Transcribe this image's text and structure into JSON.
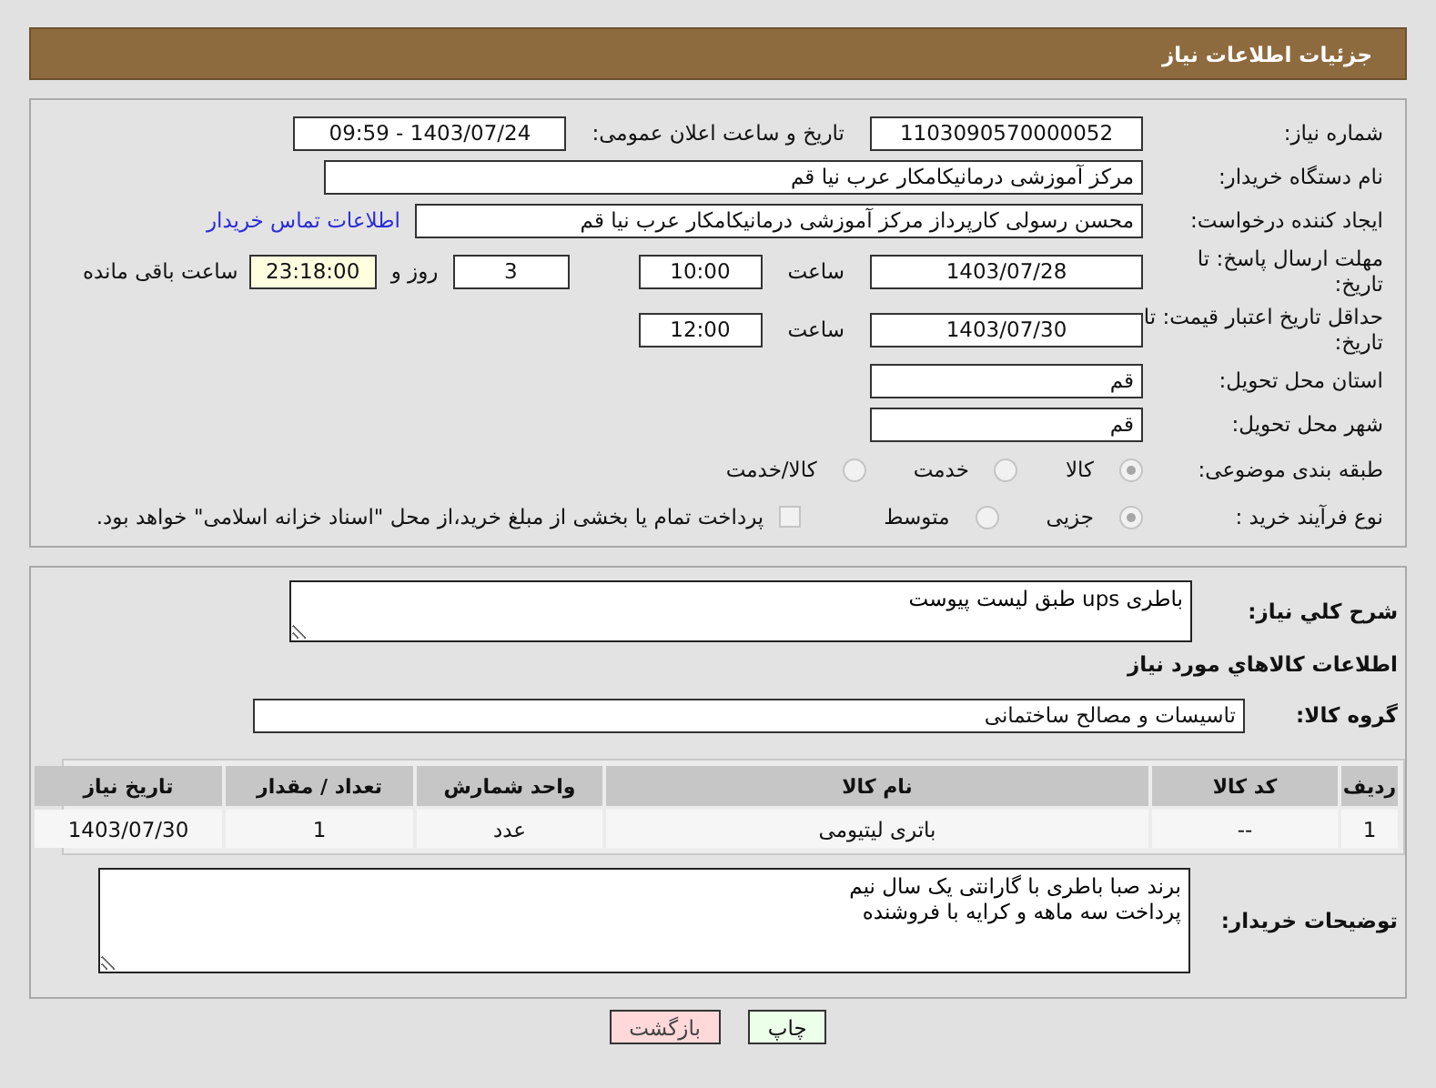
{
  "header": {
    "title": "جزئیات اطلاعات نیاز"
  },
  "details": {
    "need_number": {
      "label": "شماره نیاز:",
      "value": "1103090570000052"
    },
    "announce": {
      "label": "تاریخ و ساعت اعلان عمومی:",
      "value": "1403/07/24 - 09:59"
    },
    "buyer_org": {
      "label": "نام دستگاه خریدار:",
      "value": "مرکز آموزشی درمانیکامکار عرب نیا قم"
    },
    "requester": {
      "label": "ایجاد کننده درخواست:",
      "value": "محسن رسولی کارپرداز مرکز آموزشی درمانیکامکار عرب نیا قم",
      "link": "اطلاعات تماس خریدار"
    },
    "response_deadline": {
      "label": "مهلت ارسال پاسخ: تا تاریخ:",
      "date": "1403/07/28",
      "time_label": "ساعت",
      "time": "10:00",
      "days": "3",
      "days_label": "روز و",
      "remaining": "23:18:00",
      "remaining_label": "ساعت باقی مانده"
    },
    "price_validity": {
      "label": "حداقل تاریخ اعتبار قیمت: تا تاریخ:",
      "date": "1403/07/30",
      "time_label": "ساعت",
      "time": "12:00"
    },
    "province": {
      "label": "استان محل تحویل:",
      "value": "قم"
    },
    "city": {
      "label": "شهر محل تحویل:",
      "value": "قم"
    },
    "category": {
      "label": "طبقه بندی موضوعی:",
      "options": [
        {
          "label": "کالا",
          "selected": true
        },
        {
          "label": "خدمت",
          "selected": false
        },
        {
          "label": "کالا/خدمت",
          "selected": false
        }
      ]
    },
    "process": {
      "label": "نوع فرآیند خرید :",
      "options": [
        {
          "label": "جزیی",
          "selected": true
        },
        {
          "label": "متوسط",
          "selected": false
        }
      ],
      "treasury": {
        "checked": false,
        "text": "پرداخت تمام یا بخشی از مبلغ خرید،از محل \"اسناد خزانه اسلامی\" خواهد بود."
      }
    }
  },
  "needs": {
    "description": {
      "label": "شرح کلي نياز:",
      "value": "باطری ups طبق لیست پیوست"
    },
    "goods_heading": "اطلاعات کالاهاي مورد نياز",
    "group": {
      "label": "گروه کالا:",
      "value": "تاسیسات و مصالح ساختمانی"
    },
    "table": {
      "columns": [
        "ردیف",
        "کد کالا",
        "نام کالا",
        "واحد شمارش",
        "تعداد / مقدار",
        "تاریخ نیاز"
      ],
      "rows": [
        [
          "1",
          "--",
          "باتری لیتیومی",
          "عدد",
          "1",
          "1403/07/30"
        ]
      ]
    },
    "buyer_notes": {
      "label": "توضیحات خریدار:",
      "lines": [
        "برند صبا باطری با گارانتی یک سال نیم",
        "پرداخت سه ماهه و کرایه با فروشنده"
      ]
    }
  },
  "buttons": [
    {
      "label": "چاپ",
      "kind": "print"
    },
    {
      "label": "بازگشت",
      "kind": "back"
    }
  ]
}
